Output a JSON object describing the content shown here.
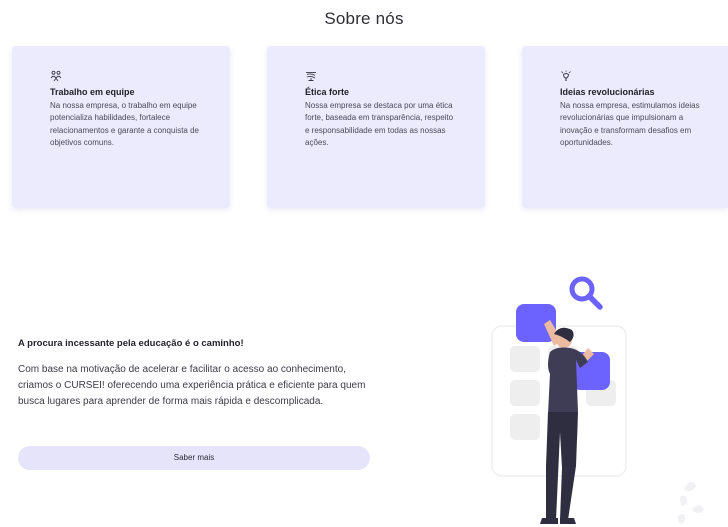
{
  "section": {
    "title": "Sobre nós"
  },
  "cards": [
    {
      "icon": "people-icon",
      "title": "Trabalho em equipe",
      "text": "Na nossa empresa, o trabalho em equipe potencializa habilidades, fortalece relacionamentos e garante a conquista de objetivos comuns."
    },
    {
      "icon": "scale-icon",
      "title": "Ética forte",
      "text": "Nossa empresa se destaca por uma ética forte, baseada em transparência, respeito e responsabilidade em todas as nossas ações."
    },
    {
      "icon": "lightbulb-icon",
      "title": "Ideias revolucionárias",
      "text": "Na nossa empresa, estimulamos ideias revolucionárias que impulsionam a inovação e transformam desafios em oportunidades."
    }
  ],
  "promo": {
    "title": "A procura incessante pela educação é o caminho!",
    "text": "Com base na motivação de acelerar e facilitar o acesso ao conhecimento, criamos o CURSEI! oferecendo uma experiência prática e eficiente para quem busca lugares para aprender de forma mais rápida e descomplicada.",
    "button_label": "Saber mais"
  },
  "colors": {
    "card_bg": "#ecebfd",
    "accent": "#6c63ff",
    "button_bg": "#e6e4fb"
  }
}
